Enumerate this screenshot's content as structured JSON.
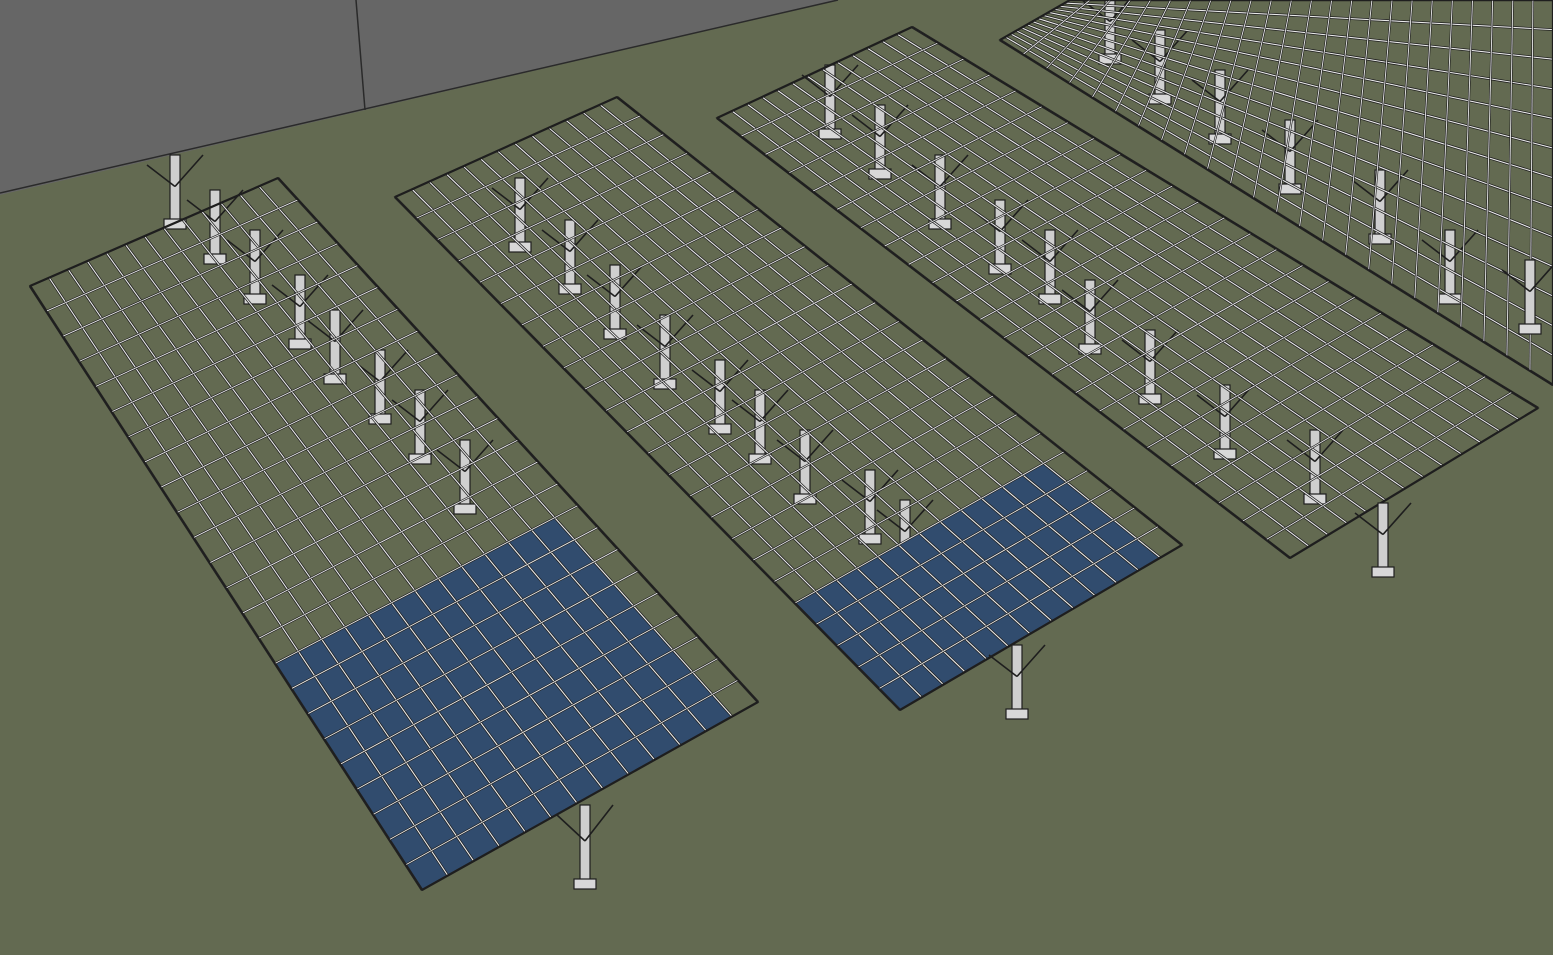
{
  "scene": {
    "ground_color": "#636a51",
    "wall_color": "#666666",
    "frame_stroke": "#1e1e1e",
    "frame_fill": "#e9e9e9",
    "panel_color": "#314c6e",
    "panel_line": "#8ea0b8"
  },
  "arrays": [
    {
      "id": "array-1",
      "panel_rows_filled": 9,
      "panel_columns_filled": 11
    },
    {
      "id": "array-2",
      "panel_rows_filled": 5,
      "panel_columns_filled": 11
    },
    {
      "id": "array-3",
      "panel_rows_filled": 0
    },
    {
      "id": "array-4",
      "panel_rows_filled": 0
    }
  ]
}
